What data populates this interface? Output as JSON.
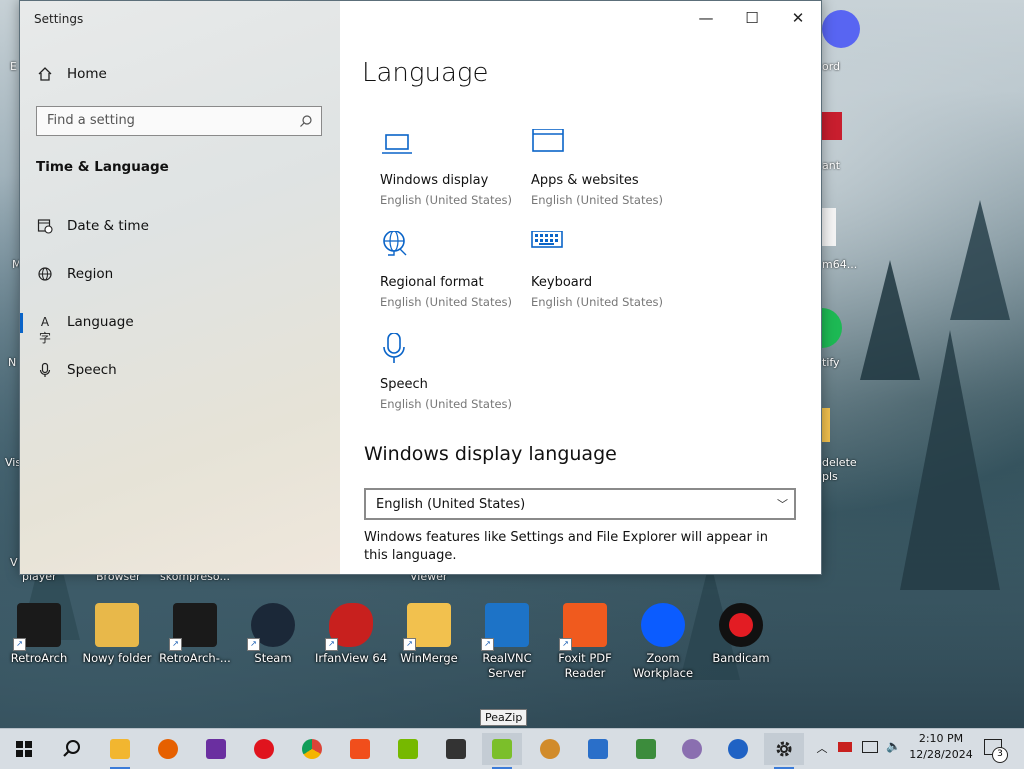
{
  "window": {
    "title": "Settings",
    "controls": {
      "minimize": "—",
      "maximize": "☐",
      "close": "✕"
    }
  },
  "sidebar": {
    "home": "Home",
    "search_placeholder": "Find a setting",
    "section": "Time & Language",
    "items": [
      {
        "label": "Date & time",
        "icon": "calendar-clock-icon"
      },
      {
        "label": "Region",
        "icon": "globe-icon"
      },
      {
        "label": "Language",
        "icon": "language-icon",
        "active": true
      },
      {
        "label": "Speech",
        "icon": "microphone-icon"
      }
    ]
  },
  "main": {
    "title": "Language",
    "tiles": [
      {
        "name": "Windows display",
        "sub": "English (United States)",
        "icon": "laptop-icon"
      },
      {
        "name": "Apps & websites",
        "sub": "English (United States)",
        "icon": "window-icon"
      },
      {
        "name": "Regional format",
        "sub": "English (United States)",
        "icon": "globe-icon"
      },
      {
        "name": "Keyboard",
        "sub": "English (United States)",
        "icon": "keyboard-icon"
      },
      {
        "name": "Speech",
        "sub": "English (United States)",
        "icon": "microphone-icon"
      }
    ],
    "display_language_heading": "Windows display language",
    "dropdown_value": "English (United States)",
    "description": "Windows features like Settings and File Explorer will appear in this language."
  },
  "desktop": {
    "icons": [
      {
        "name": "RetroArch",
        "color": "#1a1a1a"
      },
      {
        "name": "Nowy folder",
        "color": "#e8b84a"
      },
      {
        "name": "RetroArch-...",
        "color": "#1a1a1a"
      },
      {
        "name": "Steam",
        "color": "#1b2838"
      },
      {
        "name": "IrfanView 64",
        "color": "#c8201e"
      },
      {
        "name": "WinMerge",
        "color": "#f2c14e"
      },
      {
        "name": "RealVNC Server",
        "color": "#1d73c7"
      },
      {
        "name": "Foxit PDF Reader",
        "color": "#f05a1e"
      },
      {
        "name": "Zoom Workplace",
        "color": "#0b5cff"
      },
      {
        "name": "Bandicam",
        "color": "#e31c23"
      }
    ],
    "row_labels": [
      "player",
      "Browser",
      "skompreso...",
      "Viewer"
    ],
    "right_labels": [
      "ord",
      "ant",
      "m64...",
      "tify",
      "delete",
      "pls"
    ],
    "left_labels": [
      "E",
      "M",
      "N",
      "Vis",
      "V"
    ],
    "tooltip": "PeaZip"
  },
  "taskbar": {
    "apps": [
      {
        "name": "start",
        "color": "#1a1a1a"
      },
      {
        "name": "search",
        "color": "#1a1a1a"
      },
      {
        "name": "file-explorer",
        "color": "#f2b630"
      },
      {
        "name": "firefox",
        "color": "#e66000"
      },
      {
        "name": "notepad-plus",
        "color": "#6a2fa0"
      },
      {
        "name": "opera",
        "color": "#e0141e"
      },
      {
        "name": "chrome",
        "color": "#3a9a3f"
      },
      {
        "name": "brave",
        "color": "#f14e1c"
      },
      {
        "name": "nvidia",
        "color": "#76b900"
      },
      {
        "name": "321-player",
        "color": "#333333"
      },
      {
        "name": "peazip",
        "color": "#7bbf2a"
      },
      {
        "name": "app-12",
        "color": "#d18b2a"
      },
      {
        "name": "remote-desktop",
        "color": "#2a6fc9"
      },
      {
        "name": "network-tool",
        "color": "#3c8c3c"
      },
      {
        "name": "ghost-app",
        "color": "#8a6fb0"
      },
      {
        "name": "thunderbird",
        "color": "#1f62c4"
      },
      {
        "name": "settings",
        "color": "#333333"
      }
    ],
    "time": "2:10 PM",
    "date": "12/28/2024",
    "notifications": "3"
  }
}
